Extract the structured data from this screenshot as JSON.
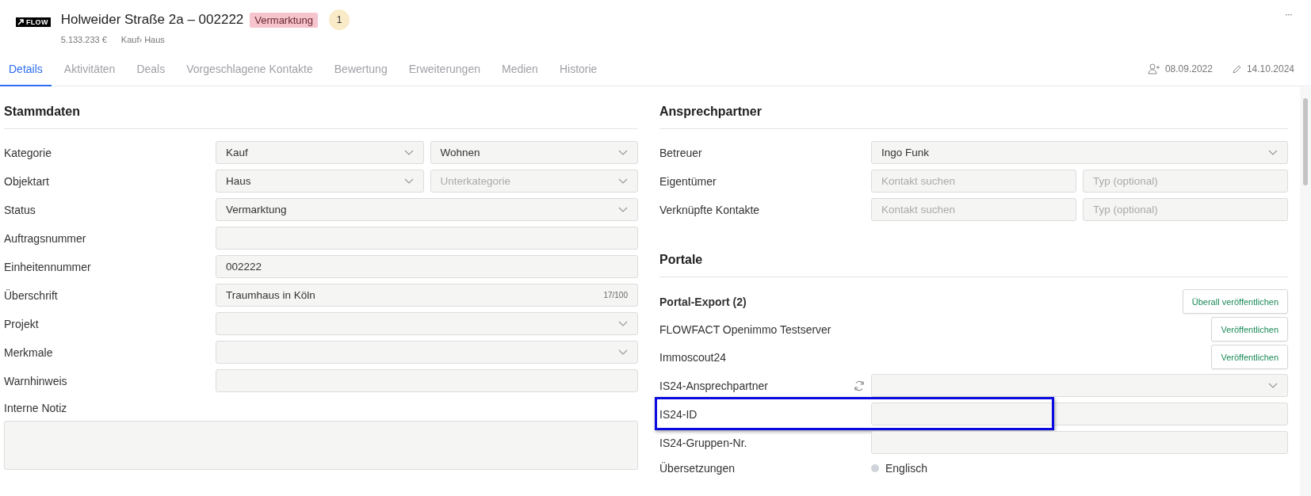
{
  "header": {
    "logo_text": "FLOW",
    "title": "Holweider Straße 2a – 002222",
    "status_badge": "Vermarktung",
    "count_badge": "1",
    "price": "5.133.233 €",
    "category": "Kauf› Haus",
    "more": "···"
  },
  "tabs": [
    {
      "label": "Details",
      "selected": true
    },
    {
      "label": "Aktivitäten",
      "selected": false
    },
    {
      "label": "Deals",
      "selected": false
    },
    {
      "label": "Vorgeschlagene Kontakte",
      "selected": false
    },
    {
      "label": "Bewertung",
      "selected": false
    },
    {
      "label": "Erweiterungen",
      "selected": false
    },
    {
      "label": "Medien",
      "selected": false
    },
    {
      "label": "Historie",
      "selected": false
    }
  ],
  "meta": {
    "created": "08.09.2022",
    "modified": "14.10.2024"
  },
  "left": {
    "heading": "Stammdaten",
    "rows": [
      {
        "label": "Kategorie",
        "fields": [
          {
            "kind": "select",
            "value": "Kauf"
          },
          {
            "kind": "select",
            "value": "Wohnen"
          }
        ]
      },
      {
        "label": "Objektart",
        "fields": [
          {
            "kind": "select",
            "value": "Haus"
          },
          {
            "kind": "select",
            "placeholder": "Unterkategorie"
          }
        ]
      },
      {
        "label": "Status",
        "fields": [
          {
            "kind": "select",
            "value": "Vermarktung"
          }
        ]
      },
      {
        "label": "Auftragsnummer",
        "fields": [
          {
            "kind": "input"
          }
        ]
      },
      {
        "label": "Einheitennummer",
        "fields": [
          {
            "kind": "input",
            "value": "002222"
          }
        ]
      },
      {
        "label": "Überschrift",
        "fields": [
          {
            "kind": "input",
            "value": "Traumhaus in Köln",
            "counter": "17/100"
          }
        ]
      },
      {
        "label": "Projekt",
        "fields": [
          {
            "kind": "select"
          }
        ]
      },
      {
        "label": "Merkmale",
        "fields": [
          {
            "kind": "select"
          }
        ]
      },
      {
        "label": "Warnhinweis",
        "fields": [
          {
            "kind": "input"
          }
        ]
      }
    ],
    "note": {
      "label": "Interne Notiz"
    }
  },
  "right": {
    "contacts": {
      "heading": "Ansprechpartner",
      "rows": [
        {
          "label": "Betreuer",
          "fields": [
            {
              "kind": "select",
              "value": "Ingo Funk"
            }
          ]
        },
        {
          "label": "Eigentümer",
          "fields": [
            {
              "kind": "input",
              "placeholder": "Kontakt suchen"
            },
            {
              "kind": "input",
              "placeholder": "Typ (optional)"
            }
          ]
        },
        {
          "label": "Verknüpfte Kontakte",
          "fields": [
            {
              "kind": "input",
              "placeholder": "Kontakt suchen"
            },
            {
              "kind": "input",
              "placeholder": "Typ (optional)"
            }
          ]
        }
      ]
    },
    "portals": {
      "heading": "Portale",
      "export_label": "Portal-Export (2)",
      "export_button": "Überall veröffentlichen",
      "list": [
        {
          "name": "FLOWFACT Openimmo Testserver",
          "button": "Veröffentlichen"
        },
        {
          "name": "Immoscout24",
          "button": "Veröffentlichen"
        }
      ],
      "rows": [
        {
          "label": "IS24-Ansprechpartner",
          "refresh": true,
          "highlighted": false,
          "fields": [
            {
              "kind": "select"
            }
          ]
        },
        {
          "label": "IS24-ID",
          "refresh": false,
          "highlighted": true,
          "fields": [
            {
              "kind": "input"
            }
          ]
        },
        {
          "label": "IS24-Gruppen-Nr.",
          "refresh": false,
          "highlighted": false,
          "fields": [
            {
              "kind": "input"
            }
          ]
        }
      ],
      "translations": {
        "label": "Übersetzungen",
        "language": "Englisch"
      }
    }
  }
}
